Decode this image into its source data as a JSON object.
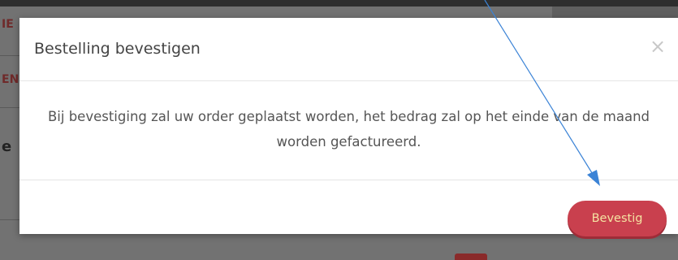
{
  "background": {
    "fragments": [
      "IE",
      "EN",
      "e"
    ]
  },
  "modal": {
    "title": "Bestelling bevestigen",
    "close_glyph": "×",
    "body_text": "Bij bevestiging zal uw order geplaatst worden, het bedrag zal op het einde van de maand worden gefactureerd.",
    "confirm_label": "Bevestig"
  },
  "colors": {
    "confirm_button": "#c9404e",
    "confirm_text": "#f5e3a2",
    "annotation_arrow": "#3b83d6"
  },
  "icons": {
    "close": "close-icon",
    "annotation": "annotation-arrow-icon"
  }
}
